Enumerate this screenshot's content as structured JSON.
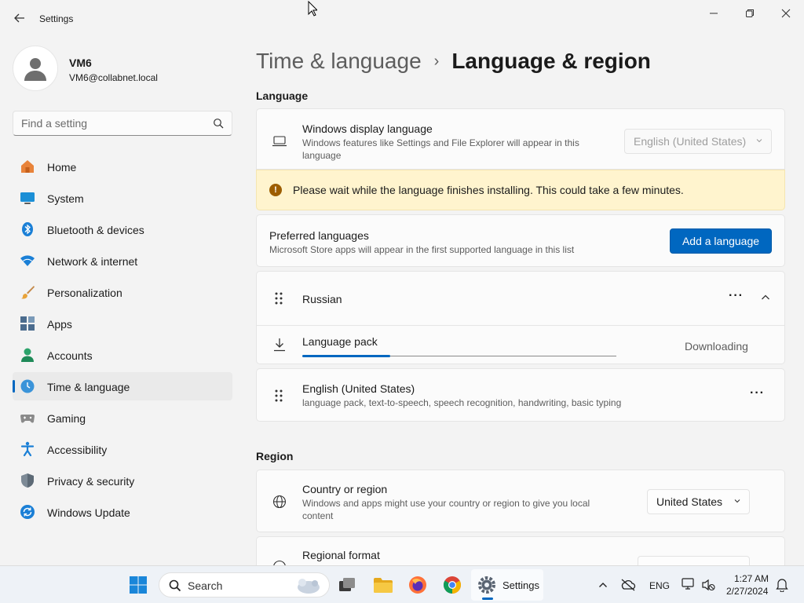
{
  "window": {
    "title": "Settings",
    "back_icon": "back-arrow-icon",
    "minimize_icon": "minimize-icon",
    "restore_icon": "restore-icon",
    "close_icon": "close-icon"
  },
  "profile": {
    "name": "VM6",
    "email": "VM6@collabnet.local"
  },
  "search": {
    "placeholder": "Find a setting",
    "value": ""
  },
  "sidebar": {
    "items": [
      {
        "label": "Home",
        "icon": "home-icon",
        "active": false
      },
      {
        "label": "System",
        "icon": "system-icon",
        "active": false
      },
      {
        "label": "Bluetooth & devices",
        "icon": "bluetooth-icon",
        "active": false
      },
      {
        "label": "Network & internet",
        "icon": "wifi-icon",
        "active": false
      },
      {
        "label": "Personalization",
        "icon": "brush-icon",
        "active": false
      },
      {
        "label": "Apps",
        "icon": "apps-icon",
        "active": false
      },
      {
        "label": "Accounts",
        "icon": "accounts-icon",
        "active": false
      },
      {
        "label": "Time & language",
        "icon": "time-language-icon",
        "active": true
      },
      {
        "label": "Gaming",
        "icon": "gaming-icon",
        "active": false
      },
      {
        "label": "Accessibility",
        "icon": "accessibility-icon",
        "active": false
      },
      {
        "label": "Privacy & security",
        "icon": "shield-icon",
        "active": false
      },
      {
        "label": "Windows Update",
        "icon": "update-icon",
        "active": false
      }
    ]
  },
  "breadcrumb": {
    "parent": "Time & language",
    "separator": "›",
    "current": "Language & region"
  },
  "language_section": {
    "title": "Language",
    "display_language": {
      "title": "Windows display language",
      "description": "Windows features like Settings and File Explorer will appear in this language",
      "value": "English (United States)",
      "disabled": true
    },
    "warning": {
      "icon": "!",
      "text": "Please wait while the language finishes installing. This could take a few minutes."
    },
    "preferred": {
      "title": "Preferred languages",
      "description": "Microsoft Store apps will appear in the first supported language in this list",
      "button": "Add a language"
    },
    "languages": [
      {
        "name": "Russian",
        "more": "···",
        "expanded": true,
        "pack": {
          "label": "Language pack",
          "status": "Downloading",
          "progress": 0.28
        }
      },
      {
        "name": "English (United States)",
        "features": "language pack, text-to-speech, speech recognition, handwriting, basic typing",
        "more": "···"
      }
    ]
  },
  "region_section": {
    "title": "Region",
    "country": {
      "title": "Country or region",
      "description": "Windows and apps might use your country or region to give you local content",
      "value": "United States"
    },
    "format": {
      "title": "Regional format"
    }
  },
  "taskbar": {
    "search_label": "Search",
    "settings_label": "Settings",
    "language": "ENG",
    "time": "1:27 AM",
    "date": "2/27/2024"
  },
  "colors": {
    "accent": "#0067c0",
    "warning_bg": "#fff4ce",
    "warning_icon": "#9d5d00"
  }
}
